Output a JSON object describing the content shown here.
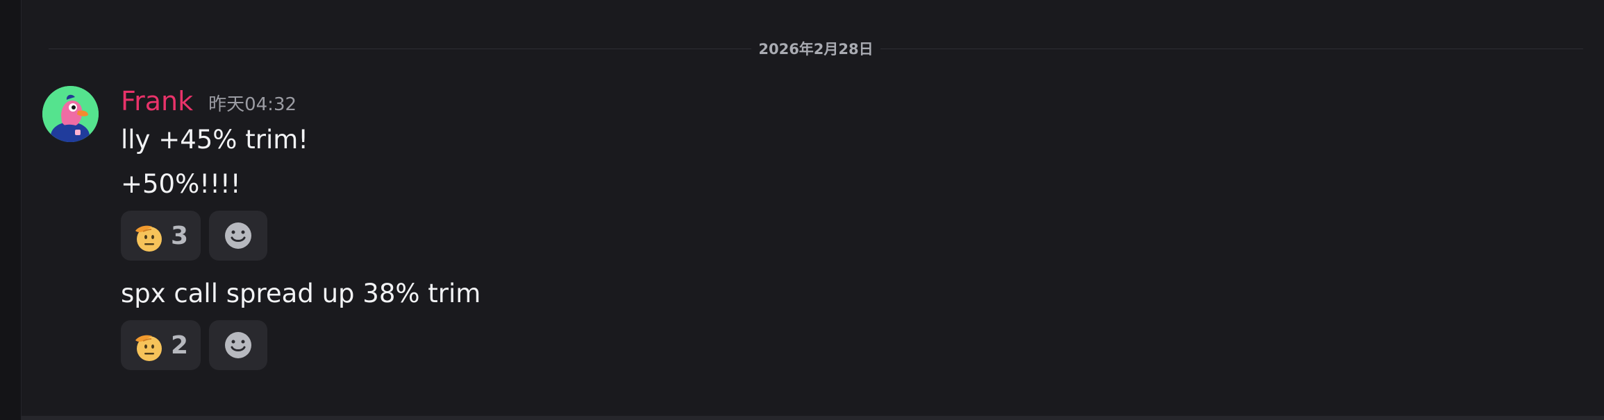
{
  "divider": {
    "date": "2026年2月28日"
  },
  "message": {
    "author": "Frank",
    "timestamp": "昨天04:32",
    "author_color": "#e9336a",
    "lines": [
      "lly +45% trim!",
      "+50%!!!!",
      "spx call spread up 38% trim"
    ],
    "reactions": [
      {
        "emoji": "saluting-face",
        "count": "3"
      },
      {
        "emoji": "saluting-face",
        "count": "2"
      }
    ]
  }
}
